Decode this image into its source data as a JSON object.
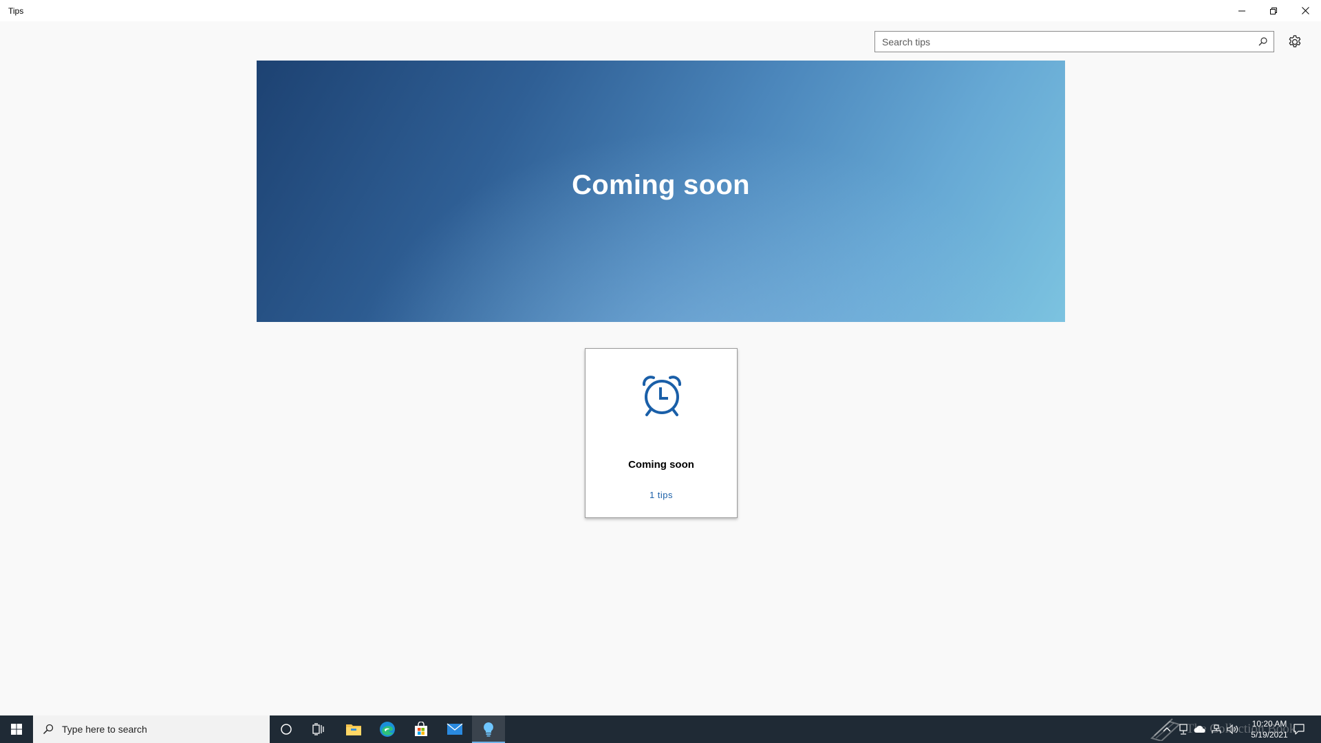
{
  "window": {
    "title": "Tips"
  },
  "search": {
    "placeholder": "Search tips",
    "value": ""
  },
  "hero": {
    "title": "Coming soon"
  },
  "collections": [
    {
      "title": "Coming soon",
      "count_label": "1 tips",
      "icon": "alarm-clock-icon"
    }
  ],
  "taskbar": {
    "search_placeholder": "Type here to search",
    "apps": [
      "windows-start-icon",
      "cortana-icon",
      "task-view-icon",
      "file-explorer-icon",
      "edge-icon",
      "store-icon",
      "mail-icon",
      "tips-icon"
    ],
    "clock": {
      "time": "10:20 AM",
      "date": "5/19/2021"
    }
  },
  "watermark": {
    "text": "The Collection Book"
  },
  "colors": {
    "accent": "#1a5fa8",
    "taskbar": "#1f2a35",
    "hero_start": "#1d4272",
    "hero_end": "#7cc3e0"
  }
}
